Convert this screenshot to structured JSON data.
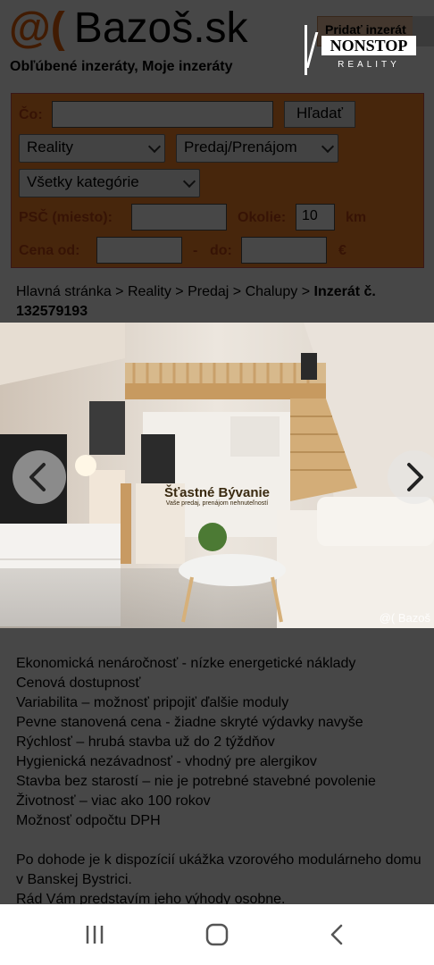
{
  "site": {
    "logo_symbol": "@(",
    "logo_text": "Bazoš.sk",
    "subtitle": "Obľúbené inzeráty, Moje inzeráty",
    "add_button": "Pridať inzerát"
  },
  "agency_logo": {
    "brand": "NONSTOP",
    "tagline": "REALITY"
  },
  "search": {
    "co_label": "Čo:",
    "co_value": "",
    "search_button": "Hľadať",
    "section_select": "Reality",
    "type_select": "Predaj/Prenájom",
    "category_select": "Všetky kategórie",
    "psc_label": "PSČ (miesto):",
    "psc_value": "",
    "okolie_label": "Okolie:",
    "okolie_value": "10",
    "km_label": "km",
    "cena_label": "Cena od:",
    "cena_od_value": "",
    "dash": "-",
    "do_label": "do:",
    "cena_do_value": "",
    "currency": "€"
  },
  "breadcrumb": {
    "path": "Hlavná stránka > Reality > Predaj > Chalupy > ",
    "current": "Inzerát č. 132579193"
  },
  "photo": {
    "watermark_name": "Šťastné Bývanie",
    "watermark_tag": "Vaše predaj, prenájom nehnuteľností",
    "bazos_mark": "@( Bazoš"
  },
  "description": {
    "lines": [
      "Ekonomická nenáročnosť - nízke energetické náklady",
      "Cenová dostupnosť",
      "Variabilita – možnosť pripojiť ďalšie moduly",
      "Pevne stanovená cena - žiadne skryté výdavky navyše",
      "Rýchlosť – hrubá stavba už do 2 týždňov",
      "Hygienická nezávadnosť - vhodný pre alergikov",
      "Stavba bez starostí – nie je potrebné stavebné povolenie",
      "Životnosť – viac ako 100 rokov",
      "Možnosť odpočtu DPH"
    ],
    "paragraph": "Po dohode je k dispozícií ukážka vzorového modulárneho domu v Banskej Bystrici.",
    "last_line": "Rád Vám predstavím jeho výhody osobne."
  },
  "colors": {
    "brand_orange": "#ff8a2b",
    "label_red": "#c34414",
    "overlay": "#000000"
  },
  "navbar": {
    "icons": [
      "recent-apps-icon",
      "home-icon",
      "back-icon"
    ]
  }
}
